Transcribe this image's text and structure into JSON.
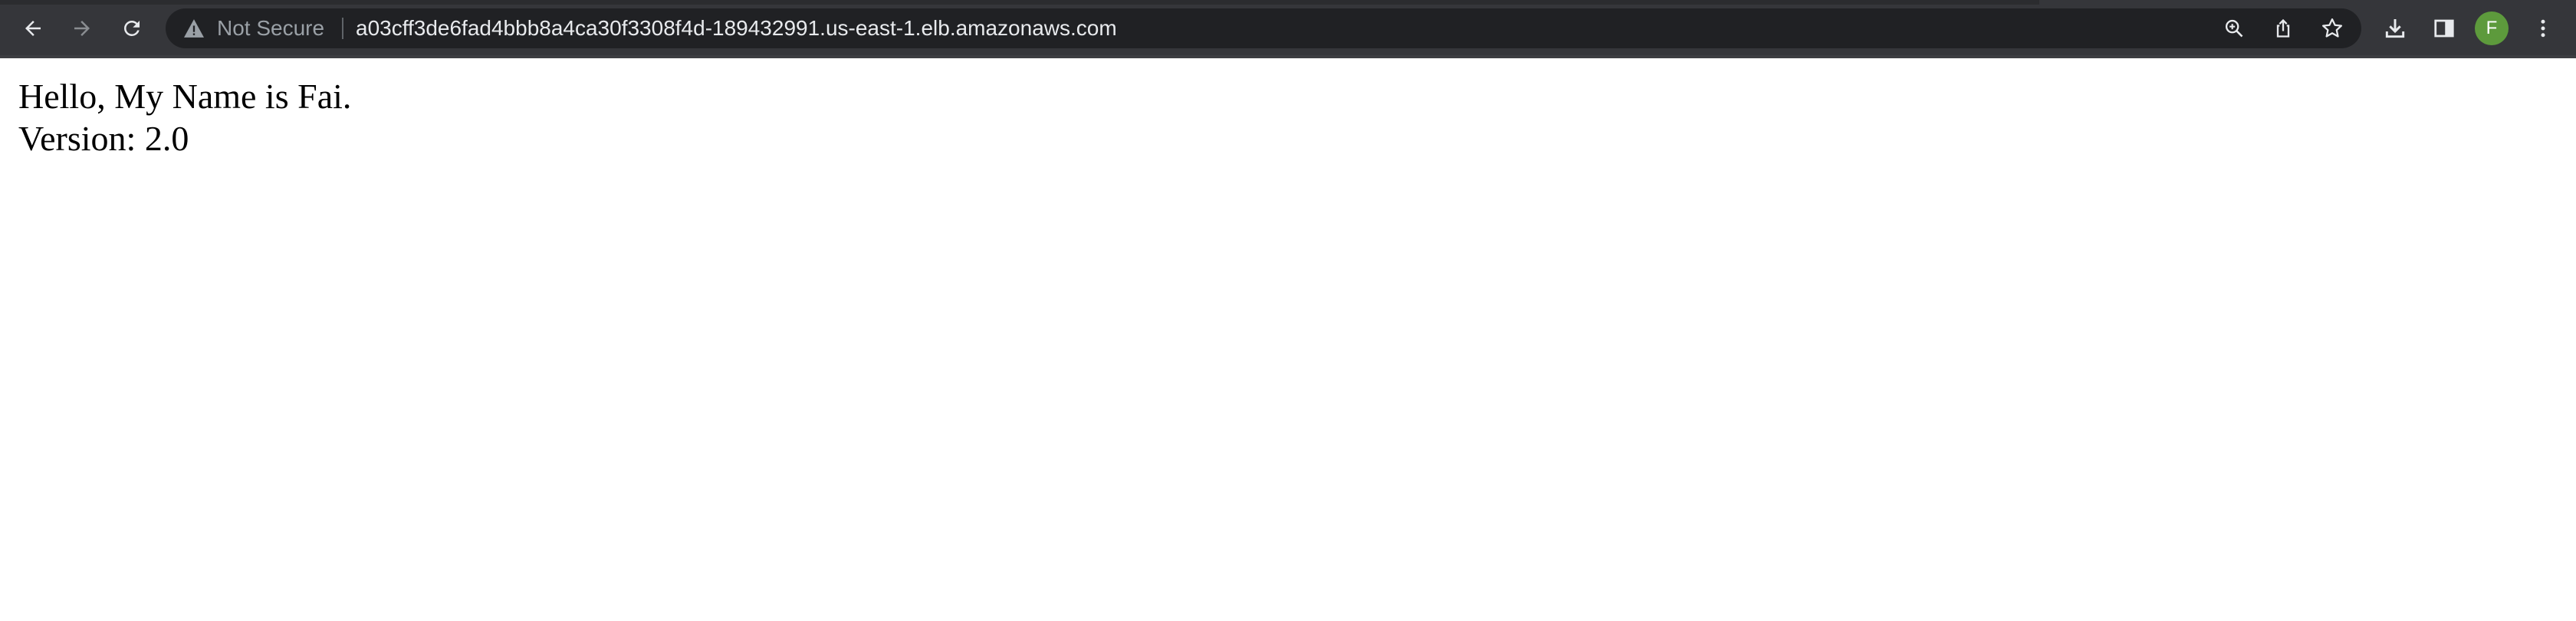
{
  "browser": {
    "security_label": "Not Secure",
    "url": "a03cff3de6fad4bbb8a4ca30f3308f4d-189432991.us-east-1.elb.amazonaws.com",
    "profile_initial": "F",
    "icons": {
      "back": "back-arrow-icon",
      "forward": "forward-arrow-icon",
      "reload": "reload-icon",
      "warning": "warning-triangle-icon",
      "zoom": "zoom-icon",
      "share": "share-icon",
      "bookmark": "star-icon",
      "downloads": "download-icon",
      "side_panel": "side-panel-icon",
      "menu": "three-dot-menu-icon"
    },
    "colors": {
      "toolbar": "#35363a",
      "omnibox": "#202124",
      "avatar": "#5d9a3c"
    }
  },
  "page": {
    "greeting": "Hello, My Name is Fai.",
    "version": "Version: 2.0"
  }
}
